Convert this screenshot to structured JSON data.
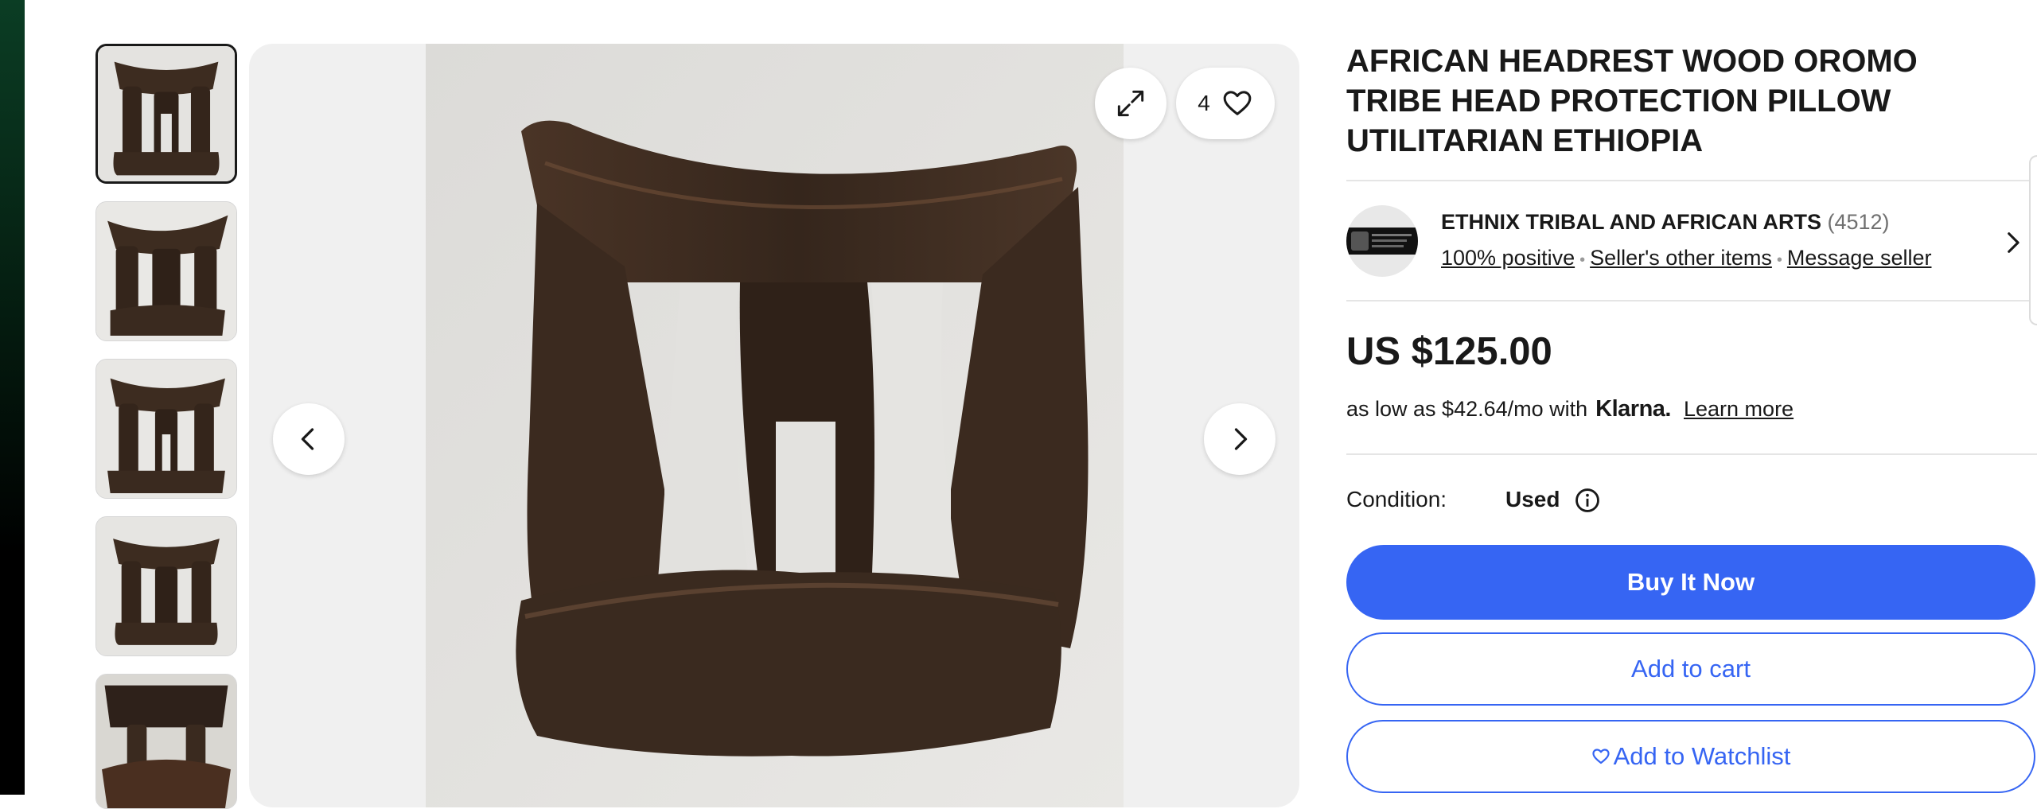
{
  "gallery": {
    "thumbnails": [
      {
        "alt": "Headrest photo 1",
        "selected": true
      },
      {
        "alt": "Headrest photo 2",
        "selected": false
      },
      {
        "alt": "Headrest photo 3",
        "selected": false
      },
      {
        "alt": "Headrest photo 4",
        "selected": false
      },
      {
        "alt": "Headrest photo 5",
        "selected": false
      }
    ],
    "watch_count": "4",
    "icons": {
      "expand": "expand-icon",
      "watch": "heart-icon",
      "prev": "chevron-left-icon",
      "next": "chevron-right-icon"
    }
  },
  "listing": {
    "title": "AFRICAN HEADREST WOOD OROMO TRIBE HEAD PROTECTION PILLOW UTILITARIAN ETHIOPIA"
  },
  "seller": {
    "name": "ETHNIX TRIBAL AND AFRICAN ARTS",
    "feedback_count": "(4512)",
    "positive": "100% positive",
    "other_items": "Seller's other items",
    "message": "Message seller"
  },
  "price": {
    "amount": "US $125.00",
    "installment_text": "as low as $42.64/mo with",
    "klarna_brand": "Klarna.",
    "learn_more": "Learn more"
  },
  "condition": {
    "label": "Condition:",
    "value": "Used"
  },
  "actions": {
    "buy_now": "Buy It Now",
    "add_to_cart": "Add to cart",
    "add_to_watchlist": "Add to Watchlist"
  },
  "colors": {
    "primary": "#3665f3",
    "text": "#191919",
    "muted": "#707070",
    "gallery_bg": "#f0f0f0",
    "wood_dark": "#3a2a1f",
    "wall": "#e7e6e3"
  }
}
